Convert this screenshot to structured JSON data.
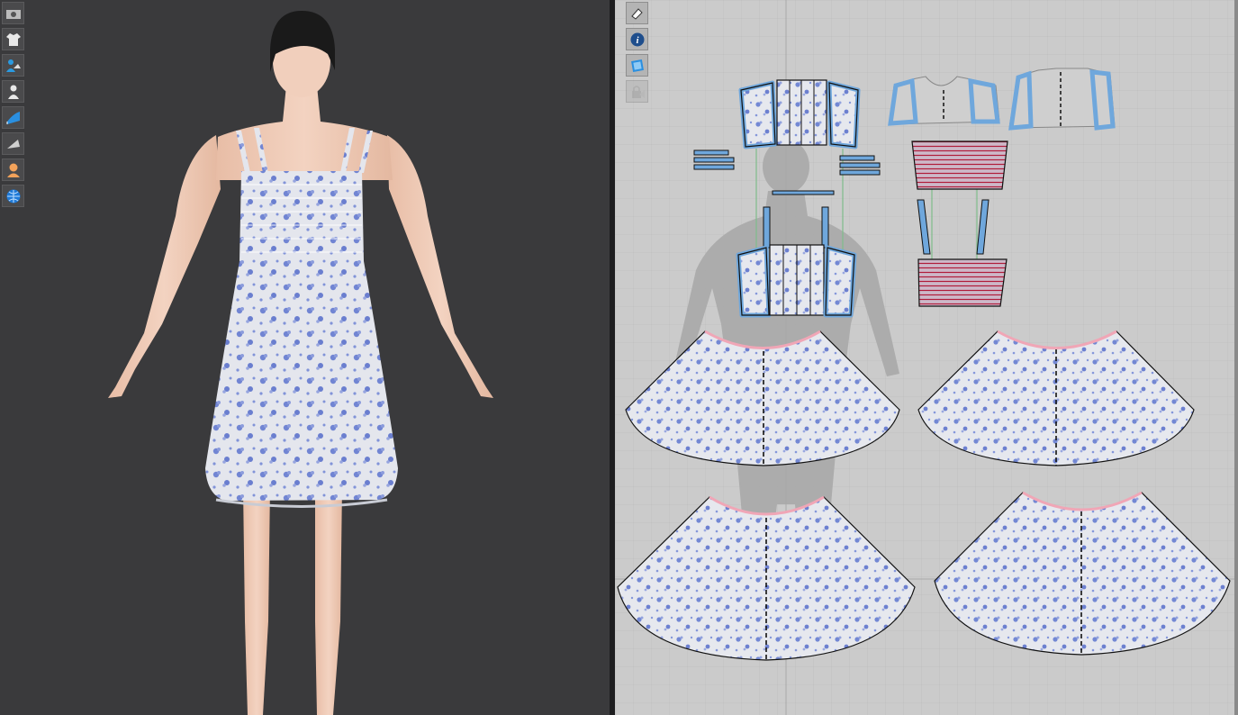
{
  "theme": {
    "viewport_3d_bg": "#3a3a3c",
    "viewport_2d_bg": "#cbcbcb",
    "fabric_base": "#e6e8ee",
    "fabric_print": "#6c80d0",
    "seam_highlight": "#6fa7dc",
    "outline": "#111111",
    "waist_line": "#f0a6b6",
    "gather_lines": "#b01c3a",
    "skin": "#efc9b4",
    "hair": "#1a1a1a"
  },
  "toolbar_3d": [
    {
      "icon": "camera-icon"
    },
    {
      "icon": "garment-display-icon"
    },
    {
      "icon": "avatar-display-icon"
    },
    {
      "icon": "avatar-pose-icon"
    },
    {
      "icon": "fabric-display-icon"
    },
    {
      "icon": "texture-display-icon"
    },
    {
      "icon": "skin-display-icon"
    },
    {
      "icon": "render-globe-icon"
    }
  ],
  "toolbar_2d": [
    {
      "icon": "sewing-display-icon"
    },
    {
      "icon": "info-icon"
    },
    {
      "icon": "pattern-display-icon"
    },
    {
      "icon": "lock-icon",
      "disabled": true
    }
  ]
}
